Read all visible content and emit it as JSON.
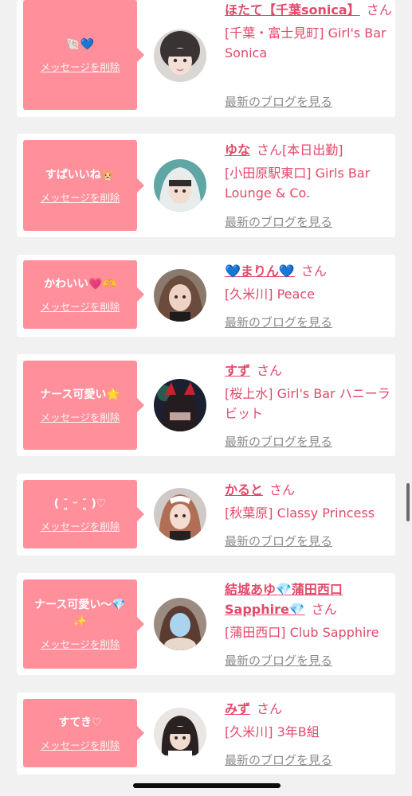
{
  "delete_label": "メッセージを削除",
  "blog_label": "最新のブログを見る",
  "san_label": "さん",
  "colors": {
    "background": "#f1f1f1",
    "card": "#ffffff",
    "bubble": "#ff8f9b",
    "name": "#e2496a",
    "link_gray": "#8b8b8b"
  },
  "cards": [
    {
      "message": "🐚💙",
      "name": "ほたて【千葉sonica】",
      "shop": "[千葉・富士見町] Girl's Bar Sonica"
    },
    {
      "message": "すぱいいね🐹",
      "name": "ゆな",
      "name_suffix": "[本日出勤]",
      "shop": "[小田原駅東口] Girls Bar Lounge & Co."
    },
    {
      "message": "かわいい💗🫶",
      "name": "💙まりん💙",
      "shop": "[久米川] Peace"
    },
    {
      "message": "ナース可愛い🌟",
      "name": "すず",
      "shop": "[桜上水] Girl's Bar ハニーラビット"
    },
    {
      "message": "( ˘͈ ᵕ ˘͈ )♡",
      "name": "かると",
      "shop": "[秋葉原] Classy Princess"
    },
    {
      "message": "ナース可愛い〜💎✨",
      "name": "結城あゆ💎蒲田西口Sapphire💎",
      "shop": "[蒲田西口] Club Sapphire"
    },
    {
      "message": "すてき♡",
      "name": "みず",
      "shop": "[久米川] 3年B組"
    }
  ]
}
